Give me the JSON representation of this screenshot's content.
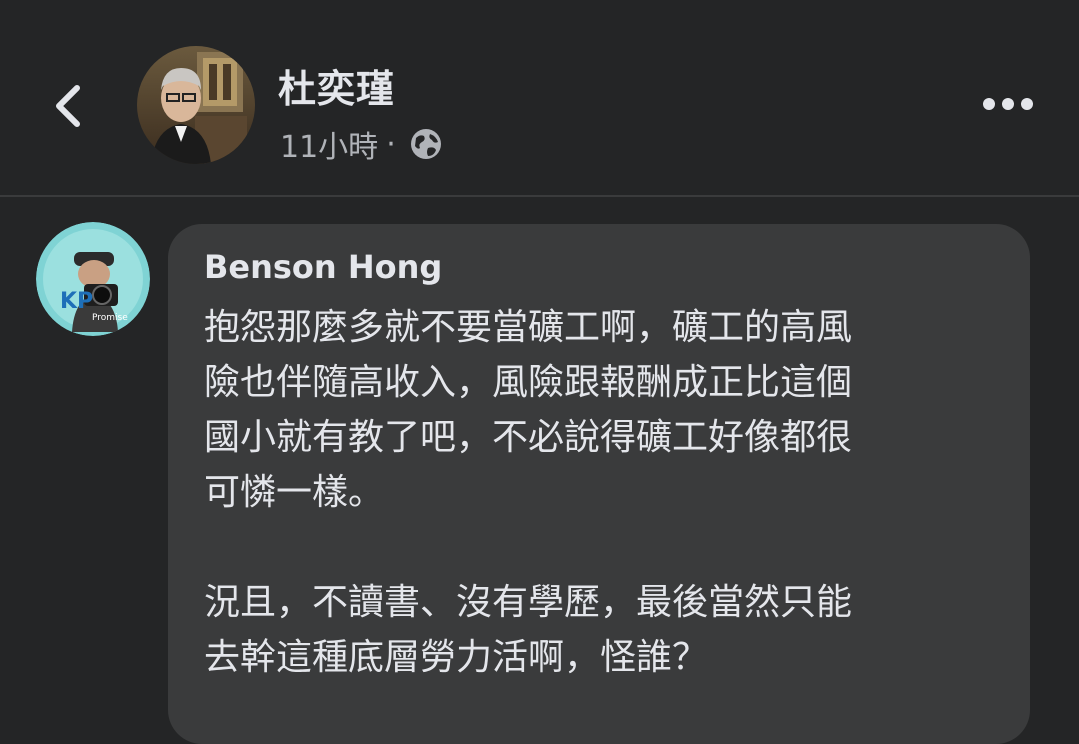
{
  "header": {
    "author_name": "杜奕瑾",
    "timestamp": "11小時",
    "separator": "·",
    "audience_icon": "globe-icon",
    "back_icon": "chevron-left-icon",
    "more_icon": "more-horizontal-icon"
  },
  "comment": {
    "author": "Benson Hong",
    "paragraphs": [
      "抱怨那麼多就不要當礦工啊，礦工的高風\n險也伴隨高收入，風險跟報酬成正比這個\n國小就有教了吧，不必說得礦工好像都很\n可憐一樣。",
      "況且，不讀書、沒有學歷，最後當然只能\n去幹這種底層勞力活啊，怪誰？"
    ],
    "avatar_text": {
      "logo": "KP",
      "brand": "Promise"
    }
  },
  "colors": {
    "background": "#242526",
    "bubble": "#3a3b3c",
    "primary_text": "#e4e6eb",
    "secondary_text": "#b0b3b8"
  }
}
